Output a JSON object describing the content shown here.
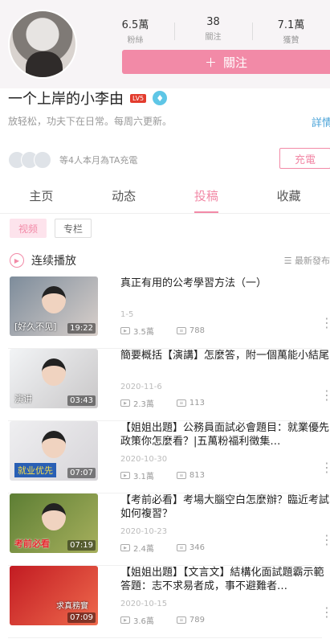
{
  "profile": {
    "followers_value": "6.5萬",
    "followers_label": "粉絲",
    "following_value": "38",
    "following_label": "關注",
    "likes_value": "7.1萬",
    "likes_label": "獲贊",
    "follow_button": "關注",
    "name": "一个上岸的小李由",
    "level": "LV5",
    "signature": "放轻松，功夫下在日常。每周六更新。",
    "detail_link": "詳情",
    "charge_text": "等4人本月為TA充電",
    "charge_button": "充電"
  },
  "tabs": [
    "主页",
    "动态",
    "投稿",
    "收藏"
  ],
  "subtabs": [
    "视频",
    "专栏"
  ],
  "playback": {
    "label": "连续播放",
    "sort_label": "最新發布"
  },
  "videos": [
    {
      "title": "真正有用的公考學習方法（一）",
      "date": "1-5",
      "duration": "19:22",
      "caption": "[好久不见]",
      "plays": "3.5萬",
      "comments": "788"
    },
    {
      "title": "簡要概括【演講】怎麼答，附一個萬能小結尾",
      "date": "2020-11-6",
      "duration": "03:43",
      "caption": "演讲",
      "plays": "2.3萬",
      "comments": "113"
    },
    {
      "title": "【姐姐出題】公務員面試必會題目：就業優先政策你怎麼看？|五萬粉福利徵集…",
      "date": "2020-10-30",
      "duration": "07:07",
      "caption": "就业优先",
      "plays": "3.1萬",
      "comments": "813"
    },
    {
      "title": "【考前必看】考場大腦空白怎麼辦？臨近考試如何複習？",
      "date": "2020-10-23",
      "duration": "07:19",
      "caption": "考前必看",
      "plays": "2.4萬",
      "comments": "346"
    },
    {
      "title": "【姐姐出題】【文言文】結構化面試題霸示範答題：志不求易者成，事不避難者…",
      "date": "2020-10-15",
      "duration": "07:09",
      "caption": "求真務實",
      "plays": "3.6萬",
      "comments": "789"
    }
  ]
}
